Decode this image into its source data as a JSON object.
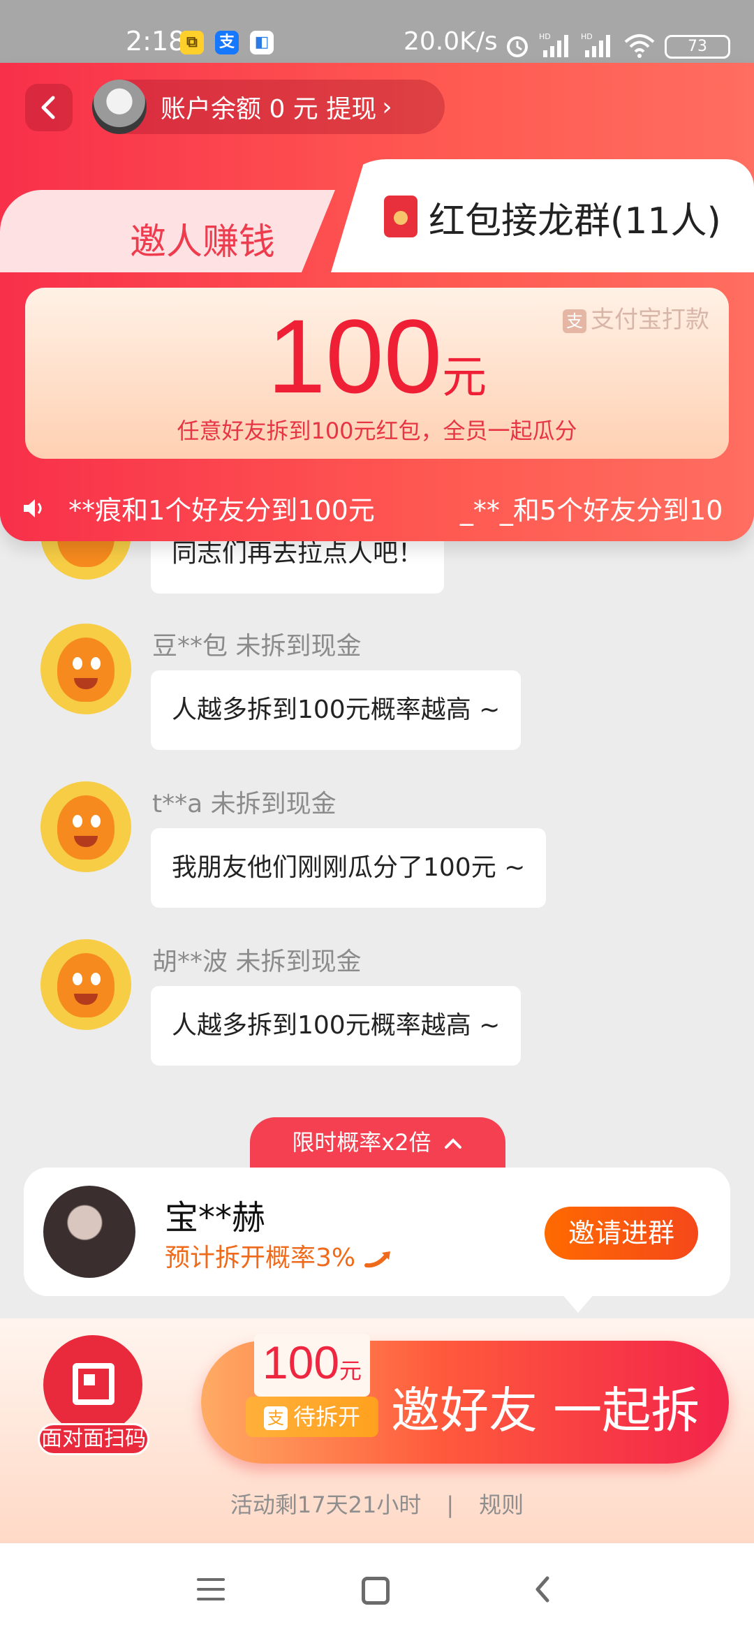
{
  "status_bar": {
    "time": "2:18",
    "network_speed": "20.0K/s",
    "battery": "73",
    "icons": [
      "copy-app-icon",
      "alipay-icon",
      "app-icon",
      "alarm-icon",
      "hd-signal-icon",
      "hd-signal-icon",
      "wifi-icon",
      "battery-icon"
    ]
  },
  "header": {
    "account_text": "账户余额 0 元 提现",
    "tabs": [
      {
        "label": "邀人赚钱",
        "active": false
      },
      {
        "label": "红包接龙群(11人)",
        "active": true
      }
    ]
  },
  "prize": {
    "alipay_label": "支付宝打款",
    "amount": "100",
    "unit": "元",
    "subtitle": "任意好友拆到100元红包，全员一起瓜分"
  },
  "ticker": {
    "messages": [
      "**痕和1个好友分到100元",
      "_**_和5个好友分到10"
    ]
  },
  "chat": [
    {
      "name": "",
      "status": "",
      "message": "同志们再去拉点人吧！"
    },
    {
      "name": "豆**包",
      "status": "未拆到现金",
      "message": "人越多拆到100元概率越高 ~"
    },
    {
      "name": "t**a",
      "status": "未拆到现金",
      "message": "我朋友他们刚刚瓜分了100元 ~"
    },
    {
      "name": "胡**波",
      "status": "未拆到现金",
      "message": "人越多拆到100元概率越高 ~"
    }
  ],
  "boost": {
    "label": "限时概率x2倍"
  },
  "invite_card": {
    "name": "宝**赫",
    "probability": "预计拆开概率3%",
    "button": "邀请进群"
  },
  "bottom": {
    "qr_label": "面对面扫码",
    "cta_amount": "100",
    "cta_unit": "元",
    "cta_pending": "待拆开",
    "cta_text": "邀好友 一起拆",
    "remaining": "活动剩17天21小时",
    "separator": "|",
    "rules": "规则"
  },
  "colors": {
    "header_red": "#f8304a",
    "accent_orange": "#ff6a00",
    "prize_red": "#ef1f36"
  }
}
